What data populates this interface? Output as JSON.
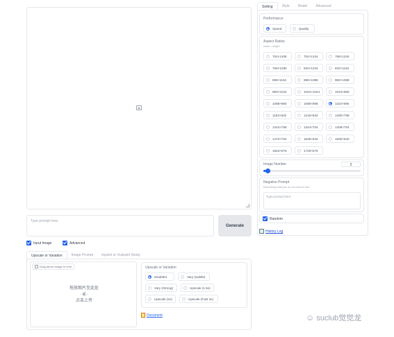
{
  "main": {
    "prompt_placeholder": "Type prompt here.",
    "generate_label": "Generate",
    "input_image_label": "Input Image",
    "advanced_label": "Advanced"
  },
  "input_image": {
    "tabs": [
      {
        "label": "Upscale or Variation",
        "active": true
      },
      {
        "label": "Image Prompt",
        "active": false
      },
      {
        "label": "Inpaint or Outpaint (beta)",
        "active": false
      }
    ],
    "drop_hint": "Drag above image to here",
    "upload_line1": "拖放图片至此处",
    "upload_line2": "- 或 -",
    "upload_line3": "点击上传",
    "upscale_title": "Upscale or Variation",
    "upscale_options": [
      {
        "label": "Disabled",
        "selected": true
      },
      {
        "label": "Vary (Subtle)",
        "selected": false
      },
      {
        "label": "Vary (Strong)",
        "selected": false
      },
      {
        "label": "Upscale (1.5x)",
        "selected": false
      },
      {
        "label": "Upscale (2x)",
        "selected": false
      },
      {
        "label": "Upscale (Fast 2x)",
        "selected": false
      }
    ],
    "document_link": "Document"
  },
  "settings": {
    "tabs": [
      {
        "label": "Setting",
        "active": true
      },
      {
        "label": "Style",
        "active": false
      },
      {
        "label": "Model",
        "active": false
      },
      {
        "label": "Advanced",
        "active": false
      }
    ],
    "performance_label": "Performance",
    "performance_options": [
      {
        "label": "Speed",
        "selected": true
      },
      {
        "label": "Quality",
        "selected": false
      }
    ],
    "aspect_label": "Aspect Ratios",
    "aspect_sub": "width × height",
    "aspect_ratios": [
      {
        "label": "704×1408",
        "selected": false
      },
      {
        "label": "704×1344",
        "selected": false
      },
      {
        "label": "768×1344",
        "selected": false
      },
      {
        "label": "768×1280",
        "selected": false
      },
      {
        "label": "832×1216",
        "selected": false
      },
      {
        "label": "832×1152",
        "selected": false
      },
      {
        "label": "896×1152",
        "selected": false
      },
      {
        "label": "896×1088",
        "selected": false
      },
      {
        "label": "960×1088",
        "selected": false
      },
      {
        "label": "960×1024",
        "selected": false
      },
      {
        "label": "1024×1024",
        "selected": false
      },
      {
        "label": "1024×960",
        "selected": false
      },
      {
        "label": "1088×960",
        "selected": false
      },
      {
        "label": "1088×896",
        "selected": false
      },
      {
        "label": "1152×896",
        "selected": true
      },
      {
        "label": "1152×832",
        "selected": false
      },
      {
        "label": "1216×832",
        "selected": false
      },
      {
        "label": "1280×768",
        "selected": false
      },
      {
        "label": "1344×768",
        "selected": false
      },
      {
        "label": "1344×704",
        "selected": false
      },
      {
        "label": "1408×704",
        "selected": false
      },
      {
        "label": "1472×704",
        "selected": false
      },
      {
        "label": "1536×640",
        "selected": false
      },
      {
        "label": "1600×640",
        "selected": false
      },
      {
        "label": "1664×576",
        "selected": false
      },
      {
        "label": "1728×576",
        "selected": false
      }
    ],
    "image_number_label": "Image Number",
    "image_number_value": "2",
    "image_number_level": 0.03,
    "negative_label": "Negative Prompt",
    "negative_sub": "Describing what you do not want to see.",
    "negative_placeholder": "Type prompt here.",
    "random_label": "Random",
    "history_link": "History Log"
  },
  "watermark": {
    "text": "suclub觉觉龙"
  },
  "colors": {
    "accent": "#2563eb",
    "border": "#e5e7eb",
    "button_bg": "#e5e7eb"
  }
}
